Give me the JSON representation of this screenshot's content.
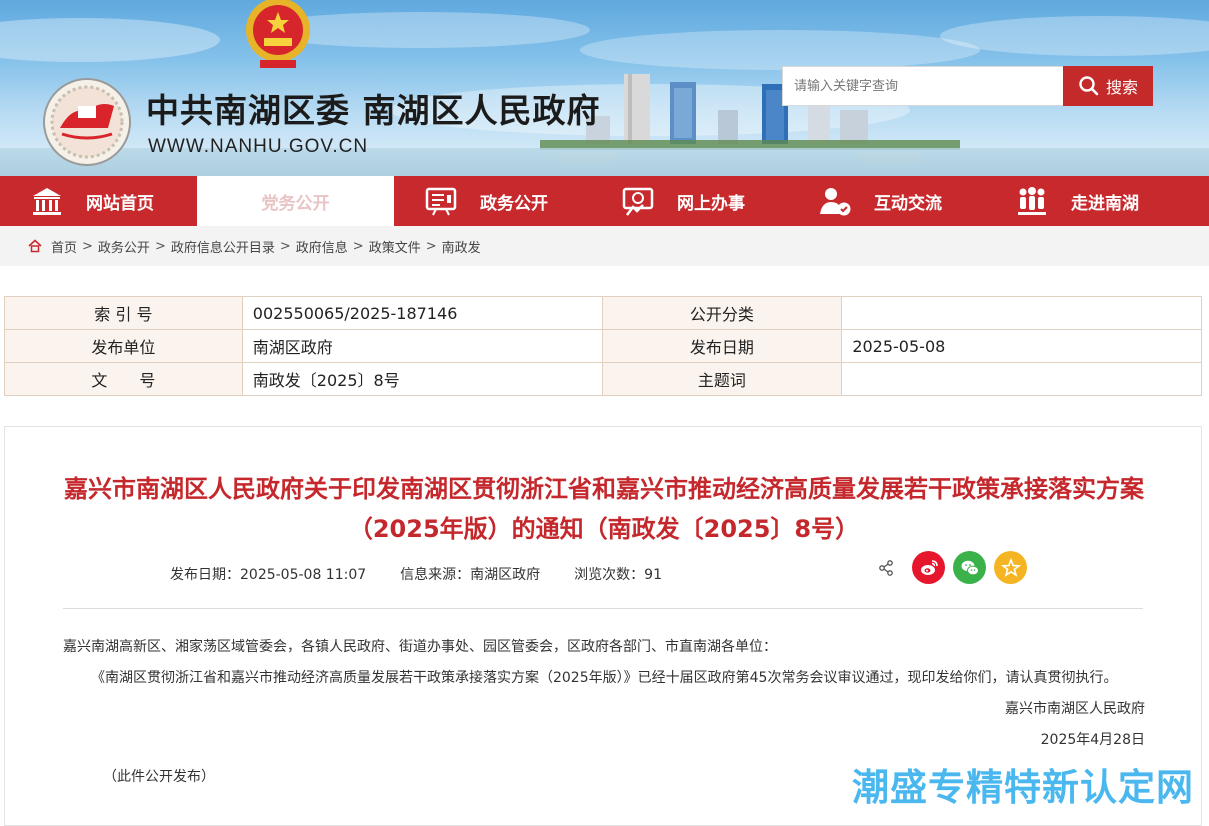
{
  "header": {
    "site_title": "中共南湖区委 南湖区人民政府",
    "site_url": "WWW.NANHU.GOV.CN",
    "search_placeholder": "请输入关键字查询",
    "search_button": "搜索"
  },
  "nav": [
    {
      "label": "网站首页",
      "icon": "building-icon"
    },
    {
      "label": "党务公开",
      "icon": "",
      "active": true
    },
    {
      "label": "政务公开",
      "icon": "board-icon"
    },
    {
      "label": "网上办事",
      "icon": "service-icon"
    },
    {
      "label": "互动交流",
      "icon": "user-chat-icon"
    },
    {
      "label": "走进南湖",
      "icon": "people-icon"
    }
  ],
  "breadcrumb": [
    "首页",
    "政务公开",
    "政府信息公开目录",
    "政府信息",
    "政策文件",
    "南政发"
  ],
  "info": {
    "index_label": "索 引 号",
    "index_value": "002550065/2025-187146",
    "category_label": "公开分类",
    "category_value": "",
    "publisher_label": "发布单位",
    "publisher_value": "南湖区政府",
    "date_label": "发布日期",
    "date_value": "2025-05-08",
    "doc_label": "文　　号",
    "doc_value": "南政发〔2025〕8号",
    "topic_label": "主题词",
    "topic_value": ""
  },
  "article": {
    "title": "嘉兴市南湖区人民政府关于印发南湖区贯彻浙江省和嘉兴市推动经济高质量发展若干政策承接落实方案（2025年版）的通知（南政发〔2025〕8号）",
    "publish_date": "发布日期：2025-05-08 11:07",
    "source": "信息来源：南湖区政府",
    "views": "浏览次数：91",
    "addressee": "嘉兴南湖高新区、湘家荡区域管委会，各镇人民政府、街道办事处、园区管委会，区政府各部门、市直南湖各单位：",
    "paragraph": "《南湖区贯彻浙江省和嘉兴市推动经济高质量发展若干政策承接落实方案（2025年版）》已经十届区政府第45次常务会议审议通过，现印发给你们，请认真贯彻执行。",
    "signature": "嘉兴市南湖区人民政府",
    "sign_date": "2025年4月28日",
    "closing": "（此件公开发布）"
  },
  "share_icons": [
    "share-icon",
    "weibo-icon",
    "wechat-icon",
    "favorite-icon"
  ],
  "colors": {
    "primary_red": "#c8292d",
    "title_red": "#c5282c",
    "weibo": "#e6162d",
    "wechat": "#3bb149",
    "favorite": "#f5b523"
  },
  "watermark": "潮盛专精特新认定网"
}
